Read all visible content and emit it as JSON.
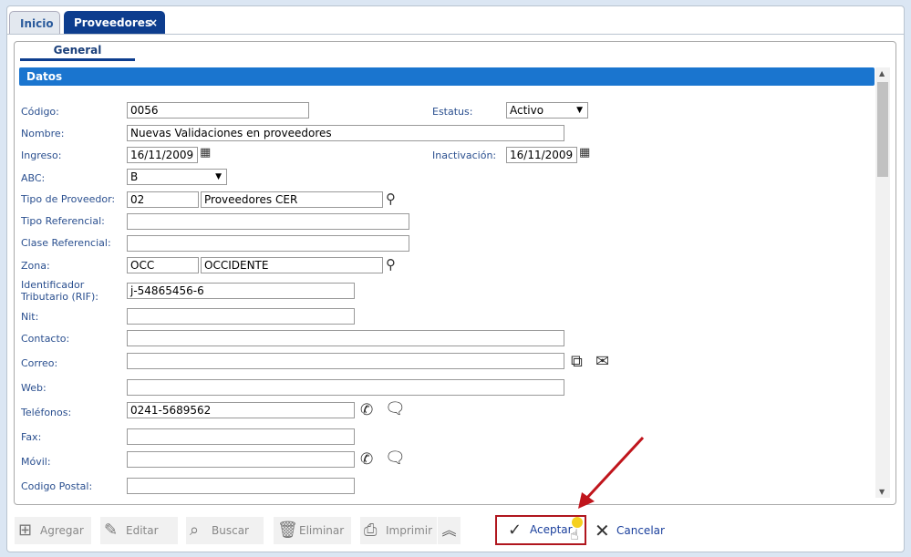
{
  "tabs": [
    {
      "label": "Inicio"
    },
    {
      "label": "Proveedores",
      "close": "×"
    }
  ],
  "subtab": "General",
  "section": "Datos",
  "fields": {
    "codigo": {
      "label": "Código:",
      "value": "0056"
    },
    "estatus": {
      "label": "Estatus:",
      "value": "Activo"
    },
    "nombre": {
      "label": "Nombre:",
      "value": "Nuevas Validaciones en proveedores"
    },
    "ingreso": {
      "label": "Ingreso:",
      "value": "16/11/2009"
    },
    "inactivacion": {
      "label": "Inactivación:",
      "value": "16/11/2009"
    },
    "abc": {
      "label": "ABC:",
      "value": "B"
    },
    "tipo_proveedor": {
      "label": "Tipo de Proveedor:",
      "code": "02",
      "desc": "Proveedores CER"
    },
    "tipo_referencial": {
      "label": "Tipo Referencial:",
      "value": ""
    },
    "clase_referencial": {
      "label": "Clase Referencial:",
      "value": ""
    },
    "zona": {
      "label": "Zona:",
      "code": "OCC",
      "desc": "OCCIDENTE"
    },
    "rif": {
      "label1": "Identificador",
      "label2": "Tributario (RIF):",
      "value": "j-54865456-6"
    },
    "nit": {
      "label": "Nit:",
      "value": ""
    },
    "contacto": {
      "label": "Contacto:",
      "value": ""
    },
    "correo": {
      "label": "Correo:",
      "value": ""
    },
    "web": {
      "label": "Web:",
      "value": ""
    },
    "telefonos": {
      "label": "Teléfonos:",
      "value": "0241-5689562"
    },
    "fax": {
      "label": "Fax:",
      "value": ""
    },
    "movil": {
      "label": "Móvil:",
      "value": ""
    },
    "codigo_postal": {
      "label": "Codigo Postal:",
      "value": ""
    }
  },
  "toolbar": {
    "agregar": "Agregar",
    "editar": "Editar",
    "buscar": "Buscar",
    "eliminar": "Eliminar",
    "imprimir": "Imprimir",
    "aceptar": "Aceptar",
    "cancelar": "Cancelar"
  }
}
